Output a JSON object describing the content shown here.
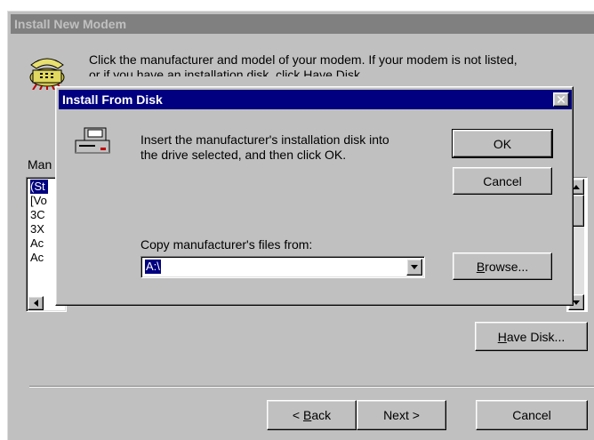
{
  "main_window": {
    "title": "Install New Modem",
    "instruction_line1": "Click the manufacturer and model of your modem. If your modem is not listed,",
    "instruction_line2": "or if you have an installation disk, click Have Disk.",
    "manufacturers_label": "Man",
    "manufacturers": [
      "(St",
      "[Vo",
      "3C",
      "3X",
      "Ac",
      "Ac"
    ],
    "have_disk_label": "Have Disk...",
    "have_disk_mnemonic": "H",
    "have_disk_rest": "ave Disk...",
    "back_mnemonic": "B",
    "back_prefix": "< ",
    "back_rest": "ack",
    "next_label": "Next >",
    "cancel_label": "Cancel"
  },
  "dialog": {
    "title": "Install From Disk",
    "close_glyph": "✕",
    "message_line1": "Insert the manufacturer's installation disk into",
    "message_line2": "the drive selected, and then click OK.",
    "ok_label": "OK",
    "cancel_label": "Cancel",
    "copy_label": "Copy manufacturer's files from:",
    "path_value": "A:\\",
    "browse_mnemonic": "B",
    "browse_rest": "rowse...",
    "icons": [
      "disk-drive-icon"
    ]
  },
  "colors": {
    "dialog_title_bg": "#000080",
    "inactive_title_bg": "#808080",
    "face": "#c0c0c0"
  }
}
